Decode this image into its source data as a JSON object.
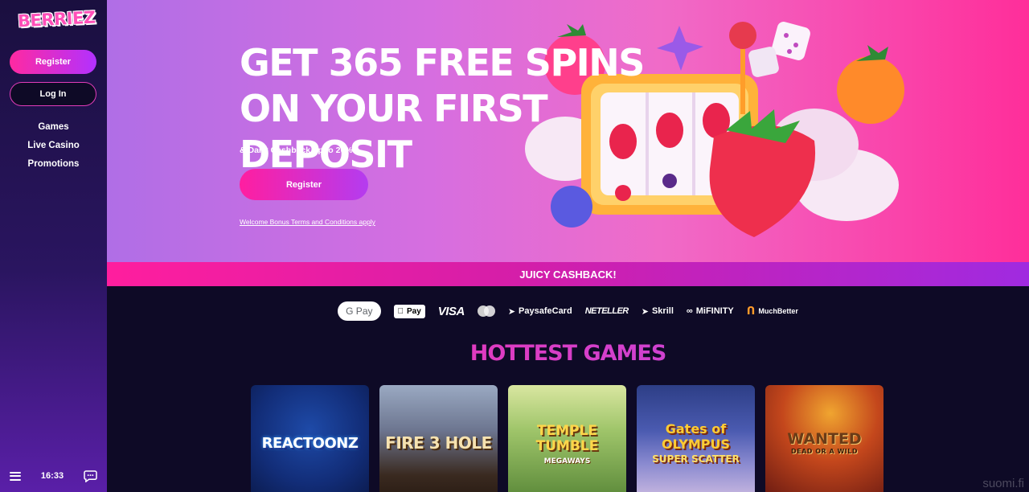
{
  "brand": {
    "logo_text": "BERRIEZ"
  },
  "sidebar": {
    "register_label": "Register",
    "login_label": "Log In",
    "nav": [
      {
        "label": "Games"
      },
      {
        "label": "Live Casino"
      },
      {
        "label": "Promotions"
      }
    ],
    "clock": "16:33"
  },
  "hero": {
    "title_line1": "GET 365 FREE SPINS",
    "title_line2": "ON YOUR FIRST DEPOSIT",
    "subtitle": "& Daily Cashback up to 20%!",
    "cta_label": "Register",
    "terms_link": "Welcome Bonus Terms and Conditions apply"
  },
  "banner": {
    "text": "JUICY CASHBACK!"
  },
  "payments": {
    "google_pay": "G Pay",
    "apple_pay": "Pay",
    "visa": "VISA",
    "paysafecard": "PaysafeCard",
    "neteller": "NETELLER",
    "skrill": "Skrill",
    "mifinity": "MiFINITY",
    "muchbetter": "MuchBetter"
  },
  "games_section": {
    "title": "HOTTEST GAMES",
    "games": [
      {
        "name": "REACTOONZ"
      },
      {
        "name": "FIRE 3 HOLE"
      },
      {
        "name": "TEMPLE TUMBLE",
        "sub": "MEGAWAYS"
      },
      {
        "name": "Gates of OLYMPUS",
        "sub": "SUPER SCATTER"
      },
      {
        "name": "WANTED",
        "sub": "DEAD OR A WILD"
      }
    ]
  },
  "watermark": "suomi.fi",
  "colors": {
    "brand_pink": "#ff1ea0",
    "brand_purple": "#b43cf0",
    "page_bg": "#0e0a26"
  }
}
